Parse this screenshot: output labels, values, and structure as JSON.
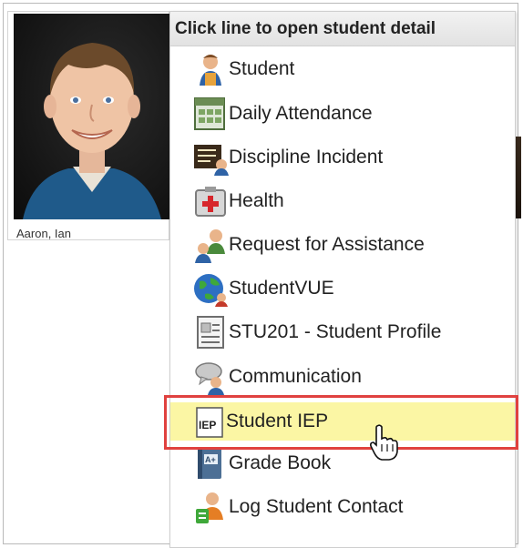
{
  "student_card": {
    "name": "Aaron, Ian"
  },
  "popup": {
    "header": "Click line to open student detail",
    "items": [
      {
        "label": "Student",
        "icon": "student-icon"
      },
      {
        "label": "Daily Attendance",
        "icon": "daily-attendance-icon"
      },
      {
        "label": "Discipline Incident",
        "icon": "discipline-icon"
      },
      {
        "label": "Health",
        "icon": "health-icon"
      },
      {
        "label": "Request for Assistance",
        "icon": "request-assistance-icon"
      },
      {
        "label": "StudentVUE",
        "icon": "globe-icon"
      },
      {
        "label": "STU201 - Student Profile",
        "icon": "report-icon"
      },
      {
        "label": "Communication",
        "icon": "communication-icon"
      },
      {
        "label": "Student IEP",
        "icon": "iep-icon",
        "highlighted": true
      },
      {
        "label": "Grade Book",
        "icon": "gradebook-icon"
      },
      {
        "label": "Log Student Contact",
        "icon": "contact-log-icon"
      }
    ]
  },
  "colors": {
    "highlight": "#fbf6a4",
    "callout_border": "#e0413f",
    "header_bg": "#e6e6e6"
  }
}
